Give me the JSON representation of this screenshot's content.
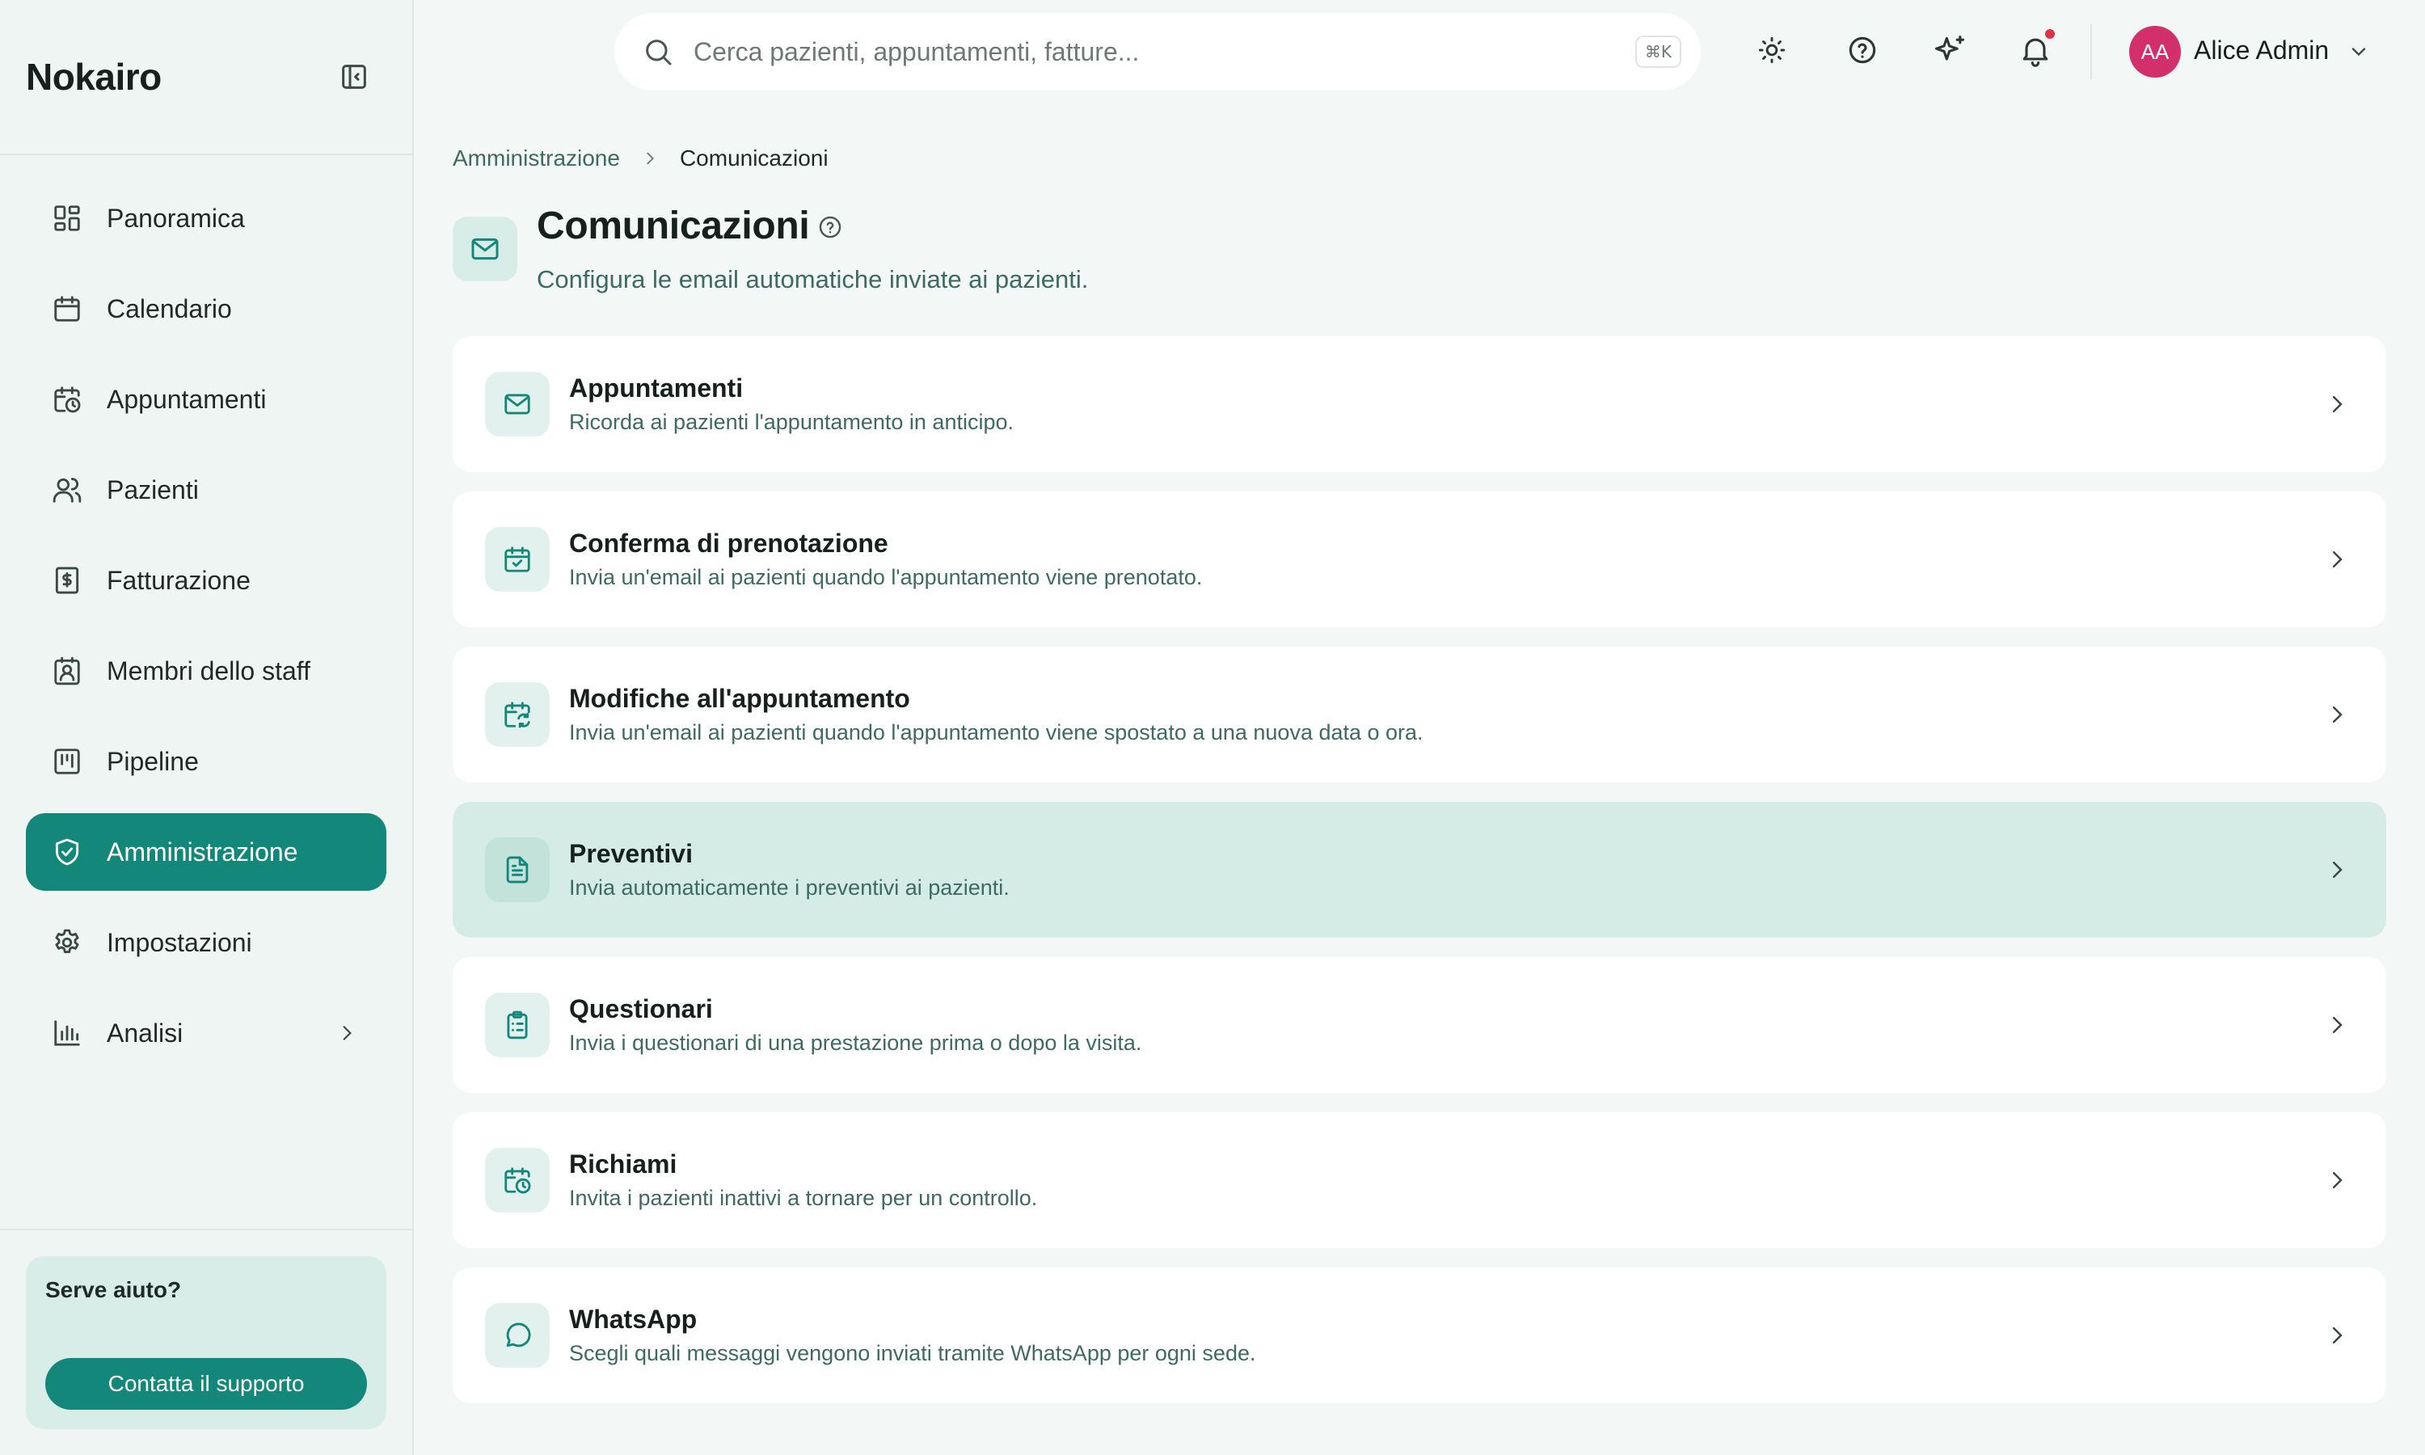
{
  "app": {
    "brand": "Nokairo"
  },
  "sidebar": {
    "items": [
      {
        "label": "Panoramica",
        "icon": "dashboard-icon"
      },
      {
        "label": "Calendario",
        "icon": "calendar-icon"
      },
      {
        "label": "Appuntamenti",
        "icon": "calendar-clock-icon"
      },
      {
        "label": "Pazienti",
        "icon": "users-icon"
      },
      {
        "label": "Fatturazione",
        "icon": "receipt-icon"
      },
      {
        "label": "Membri dello staff",
        "icon": "contact-icon"
      },
      {
        "label": "Pipeline",
        "icon": "kanban-icon"
      },
      {
        "label": "Amministrazione",
        "icon": "shield-icon",
        "active": true
      },
      {
        "label": "Impostazioni",
        "icon": "gear-icon"
      },
      {
        "label": "Analisi",
        "icon": "bar-chart-icon",
        "expandable": true
      }
    ],
    "help": {
      "title": "Serve aiuto?",
      "button": "Contatta il supporto"
    }
  },
  "topbar": {
    "search_placeholder": "Cerca pazienti, appuntamenti, fatture...",
    "search_shortcut": "⌘K",
    "user": {
      "initials": "AA",
      "name": "Alice Admin"
    }
  },
  "breadcrumb": {
    "parent": "Amministrazione",
    "current": "Comunicazioni"
  },
  "page": {
    "title": "Comunicazioni",
    "subtitle": "Configura le email automatiche inviate ai pazienti."
  },
  "communications": [
    {
      "title": "Appuntamenti",
      "description": "Ricorda ai pazienti l'appuntamento in anticipo.",
      "icon": "mail-icon"
    },
    {
      "title": "Conferma di prenotazione",
      "description": "Invia un'email ai pazienti quando l'appuntamento viene prenotato.",
      "icon": "calendar-check-icon"
    },
    {
      "title": "Modifiche all'appuntamento",
      "description": "Invia un'email ai pazienti quando l'appuntamento viene spostato a una nuova data o ora.",
      "icon": "calendar-sync-icon"
    },
    {
      "title": "Preventivi",
      "description": "Invia automaticamente i preventivi ai pazienti.",
      "icon": "file-text-icon"
    },
    {
      "title": "Questionari",
      "description": "Invia i questionari di una prestazione prima o dopo la visita.",
      "icon": "clipboard-list-icon"
    },
    {
      "title": "Richiami",
      "description": "Invita i pazienti inattivi a tornare per un controllo.",
      "icon": "calendar-clock-icon"
    },
    {
      "title": "WhatsApp",
      "description": "Scegli quali messaggi vengono inviati tramite WhatsApp per ogni sede.",
      "icon": "message-circle-icon"
    }
  ],
  "colors": {
    "accent": "#13877a",
    "highlight": "#d5ece6",
    "notification": "#e0314b",
    "avatar": "#d2306a"
  }
}
